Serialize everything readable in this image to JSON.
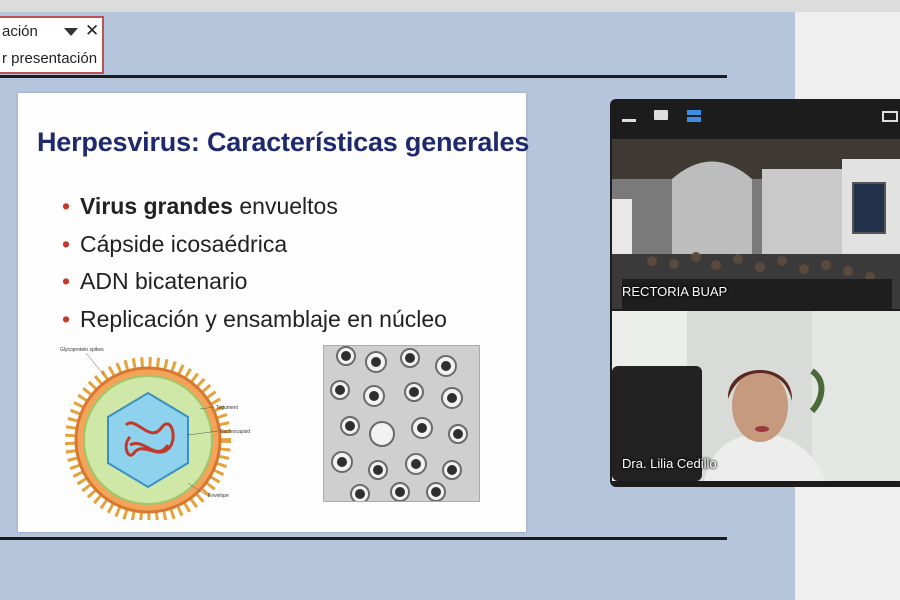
{
  "presenter_panel": {
    "title": "ación",
    "button": "r presentación"
  },
  "slide": {
    "title": "Herpesvirus: Características generales",
    "bullets": [
      {
        "bold": "Virus grandes",
        "text": " envueltos"
      },
      {
        "bold": "",
        "text": "Cápside icosaédrica"
      },
      {
        "bold": "",
        "text": "ADN bicatenario"
      },
      {
        "bold": "",
        "text": "Replicación y ensamblaje en núcleo"
      }
    ],
    "diagram_labels": [
      "Glycoprotein spikes",
      "Tegument",
      "Nucleocapsid",
      "Envelope"
    ]
  },
  "video": {
    "toolbar_icons": [
      "minimize-icon",
      "single-view-icon",
      "gallery-view-icon",
      "fullscreen-icon"
    ],
    "participants": [
      {
        "name": "RECTORIA BUAP"
      },
      {
        "name": "Dra. Lilia Cedillo"
      }
    ]
  },
  "colors": {
    "stage": "#b5c5dc",
    "slide_title": "#1f2a6e",
    "bullet": "#c0392b",
    "panel_border": "#c0504d",
    "video_bg": "#1c1c1c",
    "active_view": "#3a8ee6"
  }
}
